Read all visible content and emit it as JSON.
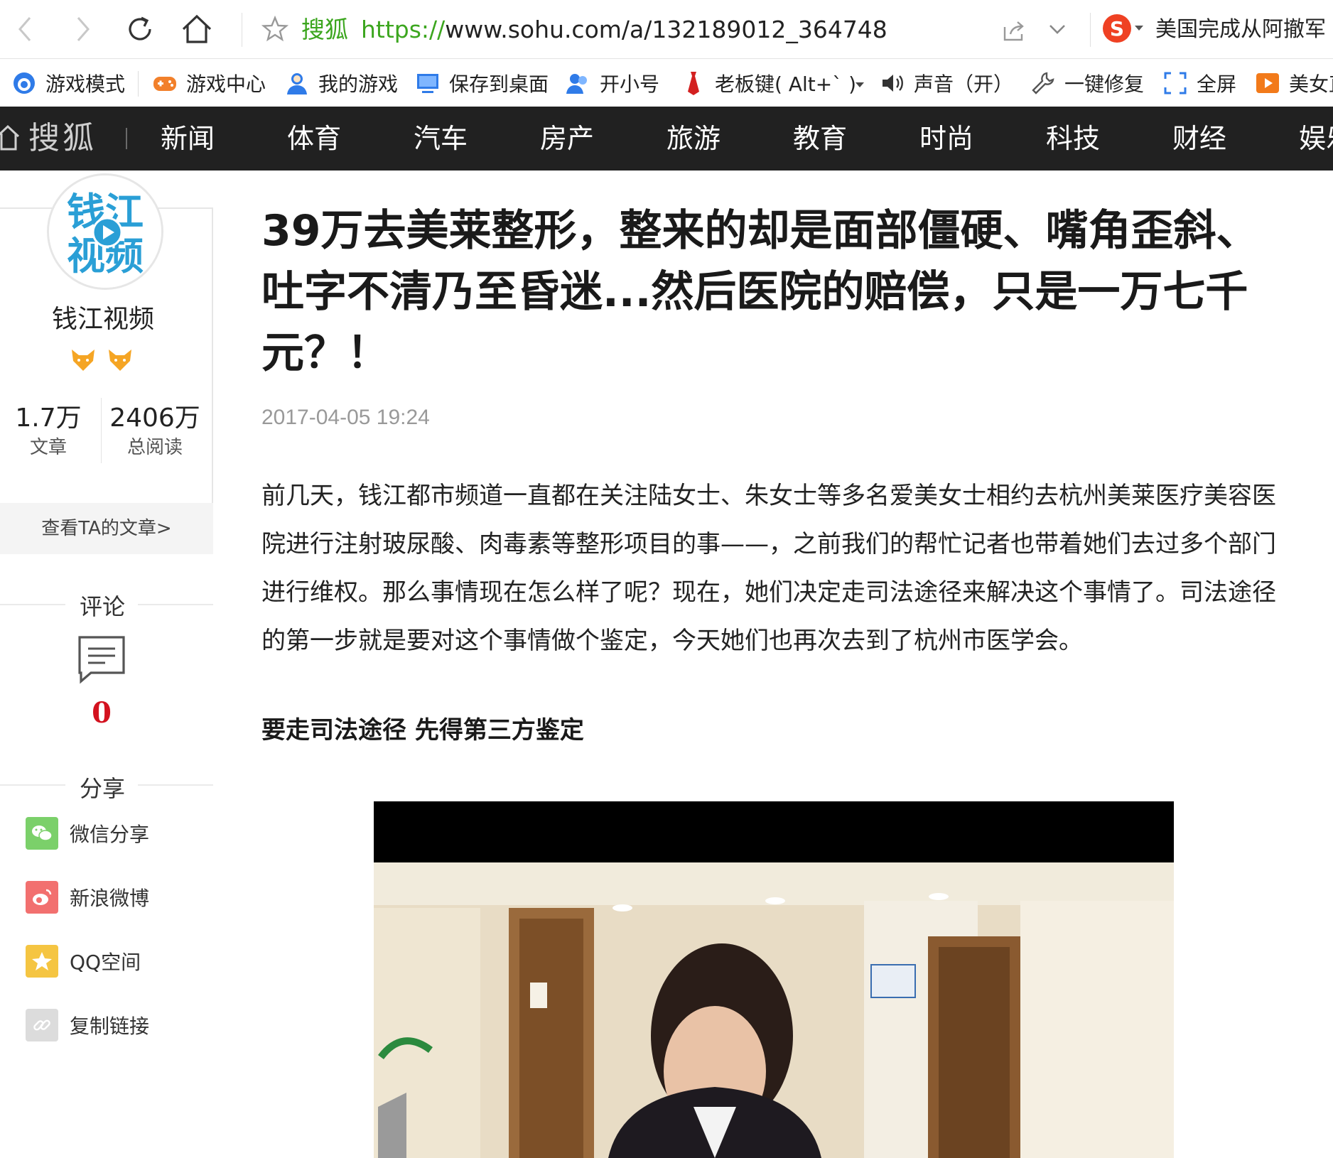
{
  "browser": {
    "site_name": "搜狐",
    "url_scheme": "https://",
    "url_rest": "www.sohu.com/a/132189012_364748",
    "search_hot": "美国完成从阿撤军",
    "search_logo": "S"
  },
  "bookmarks": [
    {
      "label": "游戏模式",
      "icon": "game-mode-icon"
    },
    {
      "label": "游戏中心",
      "icon": "game-center-icon"
    },
    {
      "label": "我的游戏",
      "icon": "my-games-icon"
    },
    {
      "label": "保存到桌面",
      "icon": "save-desktop-icon"
    },
    {
      "label": "开小号",
      "icon": "alt-account-icon"
    },
    {
      "label": "老板键( Alt+` )",
      "icon": "boss-key-icon"
    },
    {
      "label": "声音（开）",
      "icon": "sound-icon"
    },
    {
      "label": "一键修复",
      "icon": "repair-icon"
    },
    {
      "label": "全屏",
      "icon": "fullscreen-icon"
    },
    {
      "label": "美女直",
      "icon": "live-icon"
    }
  ],
  "site_nav": {
    "brand": "搜狐",
    "items": [
      "新闻",
      "体育",
      "汽车",
      "房产",
      "旅游",
      "教育",
      "时尚",
      "科技",
      "财经",
      "娱乐"
    ]
  },
  "author": {
    "avatar_text_top": "钱江",
    "avatar_text_bottom": "视频",
    "name": "钱江视频",
    "articles_value": "1.7万",
    "articles_label": "文章",
    "reads_value": "2406万",
    "reads_label": "总阅读",
    "view_articles": "查看TA的文章>"
  },
  "comments": {
    "title": "评论",
    "count": "0"
  },
  "share": {
    "title": "分享",
    "items": [
      {
        "label": "微信分享",
        "color": "#7bd06a",
        "icon": "wechat-icon"
      },
      {
        "label": "新浪微博",
        "color": "#f2706f",
        "icon": "weibo-icon"
      },
      {
        "label": "QQ空间",
        "color": "#f5c542",
        "icon": "qzone-icon"
      },
      {
        "label": "复制链接",
        "color": "#dcdcdc",
        "icon": "link-icon"
      }
    ]
  },
  "article": {
    "title": "39万去美莱整形，整来的却是面部僵硬、嘴角歪斜、吐字不清乃至昏迷...然后医院的赔偿，只是一万七千元？！",
    "time": "2017-04-05 19:24",
    "paragraph": "前几天，钱江都市频道一直都在关注陆女士、朱女士等多名爱美女士相约去杭州美莱医疗美容医院进行注射玻尿酸、肉毒素等整形项目的事——，之前我们的帮忙记者也带着她们去过多个部门进行维权。那么事情现在怎么样了呢？现在，她们决定走司法途径来解决这个事情了。司法途径的第一步就是要对这个事情做个鉴定，今天她们也再次去到了杭州市医学会。",
    "subheading": "要走司法途径 先得第三方鉴定"
  },
  "colors": {
    "accent_green": "#3ca61f",
    "nav_bg": "#212121",
    "comment_red": "#d3121f"
  }
}
